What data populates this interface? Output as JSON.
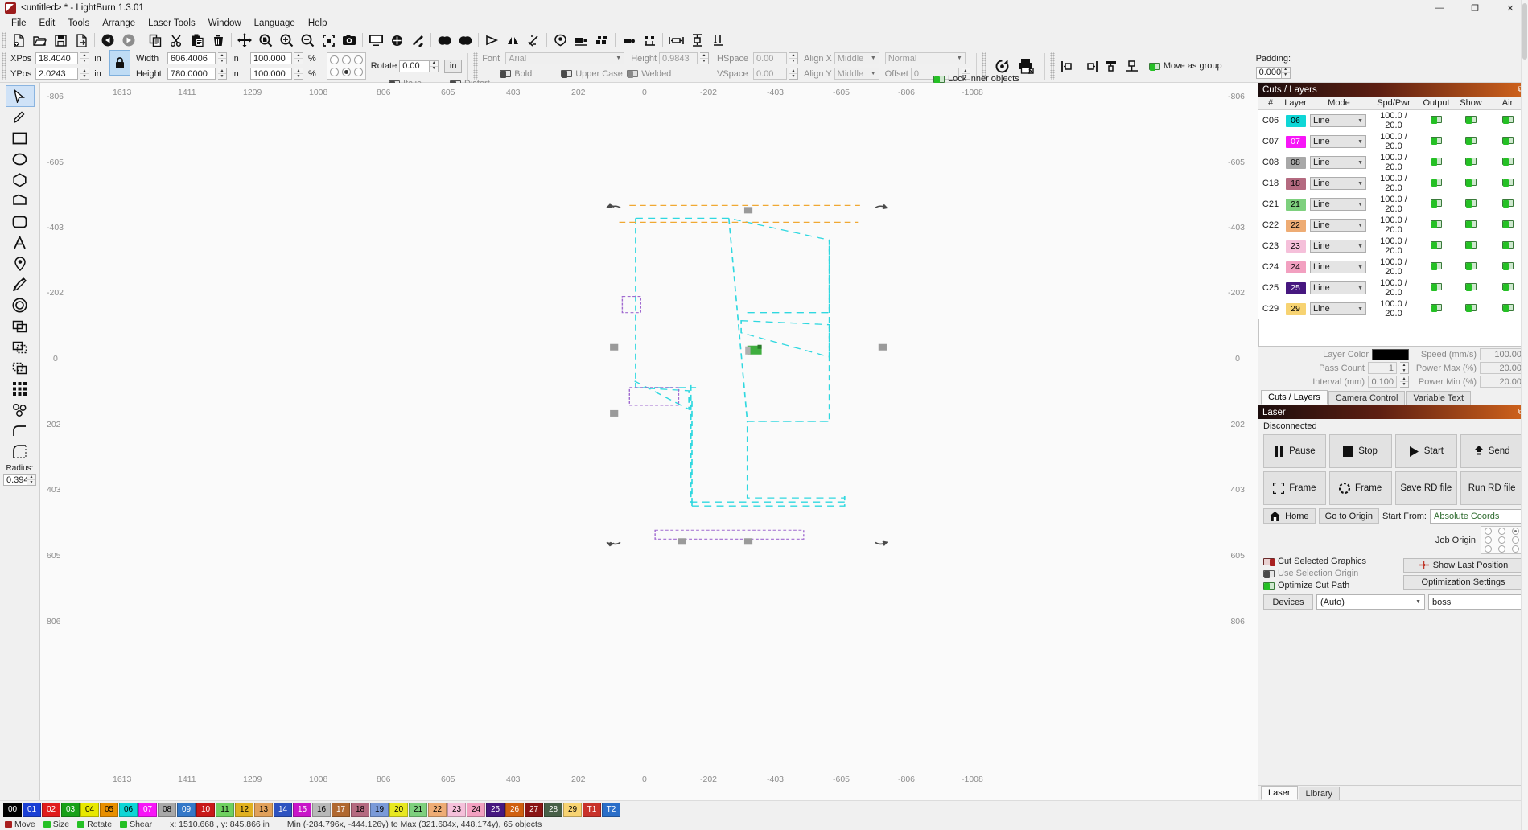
{
  "window": {
    "title": "<untitled> * - LightBurn 1.3.01",
    "minimize": "—",
    "maximize": "❐",
    "close": "✕"
  },
  "menu": [
    "File",
    "Edit",
    "Tools",
    "Arrange",
    "Laser Tools",
    "Window",
    "Language",
    "Help"
  ],
  "toolbar_icons": [
    "new-file-icon",
    "open-folder-icon",
    "save-icon",
    "export-icon",
    "undo-icon",
    "redo-icon",
    "copy-icon",
    "cut-icon",
    "paste-icon",
    "delete-icon",
    "move-icon",
    "zoom-page-icon",
    "zoom-in-icon",
    "zoom-out-icon",
    "zoom-selection-icon",
    "camera-icon",
    "frame-preview-icon",
    "pin-icon",
    "tools-icon",
    "boolean-union-icon",
    "boolean-subtract-icon",
    "flag-icon",
    "mirror-horizontal-icon",
    "mirror-vertical-icon",
    "rotate-shield-icon",
    "align-image-icon",
    "weld-icon",
    "offset-icon",
    "node-edit-icon",
    "distribute-h-icon",
    "distribute-v-icon",
    "grid-array-icon"
  ],
  "properties": {
    "xpos": {
      "label": "XPos",
      "value": "18.4040",
      "unit": "in"
    },
    "ypos": {
      "label": "YPos",
      "value": "2.0243",
      "unit": "in"
    },
    "lock_icon": "lock-icon",
    "width": {
      "label": "Width",
      "value": "606.4006",
      "unit": "in"
    },
    "height": {
      "label": "Height",
      "value": "780.0000",
      "unit": "in"
    },
    "width_pct": {
      "value": "100.000",
      "unit": "%"
    },
    "height_pct": {
      "value": "100.000",
      "unit": "%"
    },
    "anchor_selected_index": 4,
    "rotate": {
      "label": "Rotate",
      "value": "0.00",
      "unit_button": "in"
    },
    "font": {
      "label": "Font",
      "value": "Arial"
    },
    "text_height": {
      "label": "Height",
      "value": "0.9843"
    },
    "bold": {
      "label": "Bold",
      "state": "off"
    },
    "italic": {
      "label": "Italic",
      "state": "off"
    },
    "upper_case": {
      "label": "Upper Case",
      "state": "off"
    },
    "distort": {
      "label": "Distort",
      "state": "off"
    },
    "welded": {
      "label": "Welded",
      "state": "grey"
    },
    "hspace": {
      "label": "HSpace",
      "value": "0.00"
    },
    "vspace": {
      "label": "VSpace",
      "value": "0.00"
    },
    "align_x": {
      "label": "Align X",
      "value": "Middle"
    },
    "align_y": {
      "label": "Align Y",
      "value": "Middle"
    },
    "text_style": {
      "value": "Normal"
    },
    "offset": {
      "label": "Offset",
      "value": "0"
    },
    "move_as_group": {
      "label": "Move as group",
      "state": "on"
    },
    "lock_inner_objects": {
      "label": "Lock inner objects",
      "state": "on"
    },
    "padding": {
      "label": "Padding:",
      "value": "0.000"
    }
  },
  "tools": [
    {
      "name": "select-tool",
      "icon": "cursor-arrow-icon",
      "selected": true
    },
    {
      "name": "draw-lines-tool",
      "icon": "pencil-icon",
      "selected": false
    },
    {
      "name": "rectangle-tool",
      "icon": "rectangle-icon",
      "selected": false
    },
    {
      "name": "ellipse-tool",
      "icon": "ellipse-icon",
      "selected": false
    },
    {
      "name": "polygon-tool",
      "icon": "polygon-icon",
      "selected": false
    },
    {
      "name": "closed-polyline-tool",
      "icon": "closed-shape-icon",
      "selected": false
    },
    {
      "name": "rounded-rect-tool",
      "icon": "rounded-rect-icon",
      "selected": false
    },
    {
      "name": "text-tool",
      "icon": "text-a-icon",
      "selected": false
    },
    {
      "name": "position-tool",
      "icon": "map-pin-icon",
      "selected": false
    },
    {
      "name": "edit-nodes-tool",
      "icon": "node-edit-pen-icon",
      "selected": false
    },
    {
      "name": "offset-shapes-tool",
      "icon": "offset-circle-icon",
      "selected": false
    },
    {
      "name": "boolean-weld-tool",
      "icon": "boolean-weld-icon",
      "selected": false
    },
    {
      "name": "boolean-subtract-tool",
      "icon": "boolean-subtract-icon",
      "selected": false
    },
    {
      "name": "boolean-intersect-tool",
      "icon": "boolean-intersect-icon",
      "selected": false
    },
    {
      "name": "array-tool",
      "icon": "grid-array-icon",
      "selected": false
    },
    {
      "name": "trace-image-tool",
      "icon": "trace-bitmap-icon",
      "selected": false
    },
    {
      "name": "fillet-tool",
      "icon": "fillet-icon",
      "selected": false
    },
    {
      "name": "corner-radius-tool",
      "icon": "corner-radius-icon",
      "selected": false
    }
  ],
  "radius": {
    "label": "Radius:",
    "value": "0.394"
  },
  "rulers": {
    "top": [
      "1613",
      "1411",
      "1209",
      "1008",
      "806",
      "605",
      "403",
      "202",
      "0",
      "-202",
      "-403",
      "-605",
      "-806",
      "-1008"
    ],
    "bottom": [
      "1613",
      "1411",
      "1209",
      "1008",
      "806",
      "605",
      "403",
      "202",
      "0",
      "-202",
      "-403",
      "-605",
      "-806",
      "-1008"
    ],
    "left": [
      "-806",
      "-605",
      "-403",
      "-202",
      "0",
      "202",
      "403",
      "605",
      "806"
    ],
    "right": [
      "-806",
      "-605",
      "-403",
      "-202",
      "0",
      "202",
      "403",
      "605",
      "806"
    ]
  },
  "cuts_panel": {
    "title": "Cuts / Layers",
    "dock_icon": "undock-icon",
    "columns": [
      "#",
      "Layer",
      "Mode",
      "Spd/Pwr",
      "Output",
      "Show",
      "Air"
    ],
    "rows": [
      {
        "num": "C06",
        "layer": "06",
        "color": "#0fd6d6",
        "text_color": "#000000",
        "mode": "Line",
        "spdpwr": "100.0 / 20.0",
        "output": "on",
        "show": "on",
        "air": "on"
      },
      {
        "num": "C07",
        "layer": "07",
        "color": "#f715f7",
        "text_color": "#ffffff",
        "mode": "Line",
        "spdpwr": "100.0 / 20.0",
        "output": "on",
        "show": "on",
        "air": "on"
      },
      {
        "num": "C08",
        "layer": "08",
        "color": "#a8a8a8",
        "text_color": "#000000",
        "mode": "Line",
        "spdpwr": "100.0 / 20.0",
        "output": "on",
        "show": "on",
        "air": "on"
      },
      {
        "num": "C18",
        "layer": "18",
        "color": "#b46a80",
        "text_color": "#000000",
        "mode": "Line",
        "spdpwr": "100.0 / 20.0",
        "output": "on",
        "show": "on",
        "air": "on"
      },
      {
        "num": "C21",
        "layer": "21",
        "color": "#7ed07e",
        "text_color": "#000000",
        "mode": "Line",
        "spdpwr": "100.0 / 20.0",
        "output": "on",
        "show": "on",
        "air": "on"
      },
      {
        "num": "C22",
        "layer": "22",
        "color": "#eeac74",
        "text_color": "#000000",
        "mode": "Line",
        "spdpwr": "100.0 / 20.0",
        "output": "on",
        "show": "on",
        "air": "on"
      },
      {
        "num": "C23",
        "layer": "23",
        "color": "#f5c0da",
        "text_color": "#000000",
        "mode": "Line",
        "spdpwr": "100.0 / 20.0",
        "output": "on",
        "show": "on",
        "air": "on"
      },
      {
        "num": "C24",
        "layer": "24",
        "color": "#f2a0c0",
        "text_color": "#000000",
        "mode": "Line",
        "spdpwr": "100.0 / 20.0",
        "output": "on",
        "show": "on",
        "air": "on"
      },
      {
        "num": "C25",
        "layer": "25",
        "color": "#46177f",
        "text_color": "#ffffff",
        "mode": "Line",
        "spdpwr": "100.0 / 20.0",
        "output": "on",
        "show": "on",
        "air": "on"
      },
      {
        "num": "C29",
        "layer": "29",
        "color": "#f7d372",
        "text_color": "#000000",
        "mode": "Line",
        "spdpwr": "100.0 / 20.0",
        "output": "on",
        "show": "on",
        "air": "on"
      }
    ],
    "props": {
      "layer_color_label": "Layer Color",
      "layer_color_value": "#000000",
      "pass_count_label": "Pass Count",
      "pass_count_value": "1",
      "interval_label": "Interval (mm)",
      "interval_value": "0.100",
      "speed_label": "Speed (mm/s)",
      "speed_value": "100.00",
      "power_max_label": "Power Max (%)",
      "power_max_value": "20.00",
      "power_min_label": "Power Min (%)",
      "power_min_value": "20.00"
    },
    "tabs": [
      {
        "label": "Cuts / Layers",
        "active": true
      },
      {
        "label": "Camera Control",
        "active": false
      },
      {
        "label": "Variable Text",
        "active": false
      }
    ]
  },
  "laser_panel": {
    "title": "Laser",
    "dock_icon": "undock-icon",
    "status": "Disconnected",
    "buttons_row1": [
      {
        "label": "Pause",
        "icon": "pause-icon"
      },
      {
        "label": "Stop",
        "icon": "stop-icon"
      },
      {
        "label": "Start",
        "icon": "play-icon"
      },
      {
        "label": "Send",
        "icon": "send-up-icon"
      }
    ],
    "buttons_row2": [
      {
        "label": "Frame",
        "icon": "frame-square-icon"
      },
      {
        "label": "Frame",
        "icon": "frame-round-icon"
      },
      {
        "label": "Save RD file",
        "icon": ""
      },
      {
        "label": "Run RD file",
        "icon": ""
      }
    ],
    "home_label": "Home",
    "home_icon": "home-icon",
    "go_to_origin_label": "Go to Origin",
    "start_from_label": "Start From:",
    "start_from_value": "Absolute Coords",
    "job_origin_label": "Job Origin",
    "job_origin_selected": 2,
    "cut_selected_graphics": {
      "label": "Cut Selected Graphics",
      "state": "red"
    },
    "use_selection_origin": {
      "label": "Use Selection Origin",
      "state": "off"
    },
    "optimize_cut_path": {
      "label": "Optimize Cut Path",
      "state": "on"
    },
    "show_last_position": {
      "label": "Show Last Position",
      "icon": "crosshair-icon"
    },
    "optimization_settings": {
      "label": "Optimization Settings"
    },
    "devices_label": "Devices",
    "device_combo_value": "(Auto)",
    "device_name_value": "boss",
    "bottom_tabs": [
      {
        "label": "Laser",
        "active": true
      },
      {
        "label": "Library",
        "active": false
      }
    ]
  },
  "palette": [
    {
      "id": "00",
      "color": "#000000",
      "fg": "#ffffff"
    },
    {
      "id": "01",
      "color": "#1a3fd4",
      "fg": "#ffffff"
    },
    {
      "id": "02",
      "color": "#e01b1b",
      "fg": "#ffffff"
    },
    {
      "id": "03",
      "color": "#18a018",
      "fg": "#ffffff"
    },
    {
      "id": "04",
      "color": "#e8e800",
      "fg": "#000000"
    },
    {
      "id": "05",
      "color": "#e88f00",
      "fg": "#000000"
    },
    {
      "id": "06",
      "color": "#0fd6d6",
      "fg": "#000000"
    },
    {
      "id": "07",
      "color": "#f715f7",
      "fg": "#ffffff"
    },
    {
      "id": "08",
      "color": "#a8a8a8",
      "fg": "#000000"
    },
    {
      "id": "09",
      "color": "#3478c8",
      "fg": "#ffffff"
    },
    {
      "id": "10",
      "color": "#c81818",
      "fg": "#ffffff"
    },
    {
      "id": "11",
      "color": "#6fd060",
      "fg": "#000000"
    },
    {
      "id": "12",
      "color": "#e0b020",
      "fg": "#000000"
    },
    {
      "id": "13",
      "color": "#e0a05a",
      "fg": "#000000"
    },
    {
      "id": "14",
      "color": "#2e53c0",
      "fg": "#ffffff"
    },
    {
      "id": "15",
      "color": "#c814c8",
      "fg": "#ffffff"
    },
    {
      "id": "16",
      "color": "#b8b8b8",
      "fg": "#000000"
    },
    {
      "id": "17",
      "color": "#b06830",
      "fg": "#ffffff"
    },
    {
      "id": "18",
      "color": "#b46a80",
      "fg": "#000000"
    },
    {
      "id": "19",
      "color": "#7a9ad8",
      "fg": "#000000"
    },
    {
      "id": "20",
      "color": "#e8e820",
      "fg": "#000000"
    },
    {
      "id": "21",
      "color": "#7ed07e",
      "fg": "#000000"
    },
    {
      "id": "22",
      "color": "#eeac74",
      "fg": "#000000"
    },
    {
      "id": "23",
      "color": "#f5c0da",
      "fg": "#000000"
    },
    {
      "id": "24",
      "color": "#f2a0c0",
      "fg": "#000000"
    },
    {
      "id": "25",
      "color": "#46177f",
      "fg": "#ffffff"
    },
    {
      "id": "26",
      "color": "#d06010",
      "fg": "#ffffff"
    },
    {
      "id": "27",
      "color": "#8a1515",
      "fg": "#ffffff"
    },
    {
      "id": "28",
      "color": "#486048",
      "fg": "#ffffff"
    },
    {
      "id": "29",
      "color": "#f7d372",
      "fg": "#000000"
    },
    {
      "id": "T1",
      "color": "#c8322a",
      "fg": "#ffffff"
    },
    {
      "id": "T2",
      "color": "#2a6ec8",
      "fg": "#ffffff"
    }
  ],
  "statusbar": {
    "move": {
      "label": "Move",
      "state": "red"
    },
    "size": {
      "label": "Size",
      "state": "on"
    },
    "rotate": {
      "label": "Rotate",
      "state": "on"
    },
    "shear": {
      "label": "Shear",
      "state": "on"
    },
    "coords": "x: 1510.668 , y: 845.866 in",
    "bounds": "Min (-284.796x, -444.126y) to Max (321.604x, 448.174y), 65 objects"
  }
}
